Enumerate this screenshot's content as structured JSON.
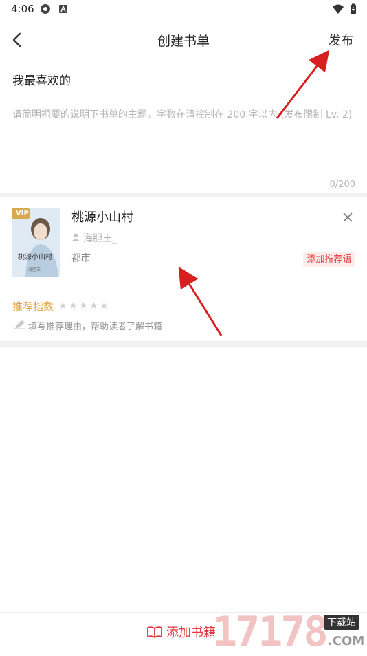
{
  "status": {
    "time": "4:06"
  },
  "header": {
    "title": "创建书单",
    "publish_label": "发布"
  },
  "booklist": {
    "name": "我最喜欢的",
    "description_placeholder": "请简明扼要的说明下书单的主题，字数在请控制在 200 字以内 (发布限制 Lv. 2)",
    "char_count": "0/200"
  },
  "book": {
    "title": "桃源小山村",
    "author": "海胆王_",
    "genre": "都市",
    "cover_badge": "VIP",
    "cover_title": "桃源小山村",
    "cover_author": "海胆王_",
    "add_recommendation_label": "添加推荐语",
    "rating_label": "推荐指数",
    "rating_value": 0,
    "rating_max": 5,
    "reason_placeholder": "填写推荐理由，帮助读者了解书籍"
  },
  "bottom": {
    "add_books_label": "添加书籍"
  },
  "watermark": {
    "site": "17178",
    "tag": "下载站",
    "domain": ".COM"
  },
  "colors": {
    "accent": "#e03a3a",
    "rating": "#e6a23c",
    "arrow": "#d62020"
  }
}
